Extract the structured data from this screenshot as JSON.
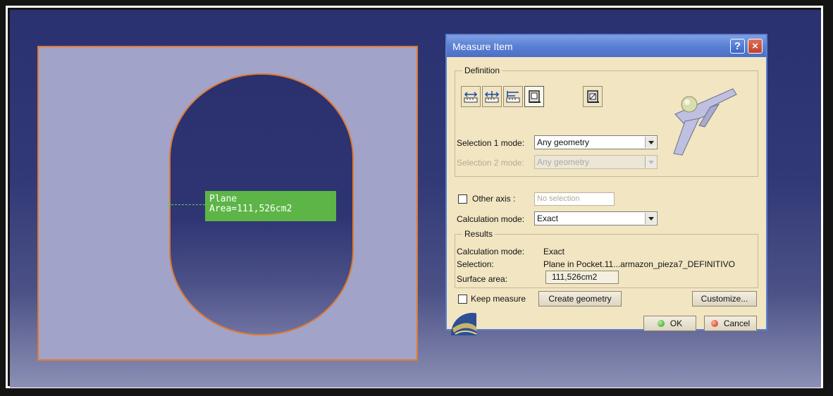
{
  "viewport": {
    "label_title": "Plane",
    "label_value": "Area=111,526cm2",
    "colors": {
      "face": "#a1a3c9",
      "edge": "#e07a2e",
      "label_bg": "#5cb546"
    }
  },
  "dialog": {
    "title": "Measure Item",
    "help_icon": "?",
    "close_icon": "×",
    "definition": {
      "legend": "Definition",
      "tools": [
        "measure-between-icon",
        "measure-between-chain-icon",
        "measure-between-fan-icon",
        "measure-item-icon",
        "measure-thickness-icon"
      ],
      "selection1_label": "Selection 1 mode:",
      "selection1_value": "Any geometry",
      "selection2_label": "Selection 2 mode:",
      "selection2_value": "Any geometry",
      "other_axis_label": "Other axis :",
      "other_axis_placeholder": "No selection",
      "calc_mode_label": "Calculation mode:",
      "calc_mode_value": "Exact"
    },
    "results": {
      "legend": "Results",
      "calc_mode_label": "Calculation mode:",
      "calc_mode_value": "Exact",
      "selection_label": "Selection:",
      "selection_value": "Plane in Pocket.11...armazon_pieza7_DEFINITIVO",
      "surface_label": "Surface area:",
      "surface_value": "111,526cm2"
    },
    "keep_measure_label": "Keep measure",
    "create_geometry_label": "Create geometry",
    "customize_label": "Customize...",
    "ok_label": "OK",
    "cancel_label": "Cancel"
  }
}
